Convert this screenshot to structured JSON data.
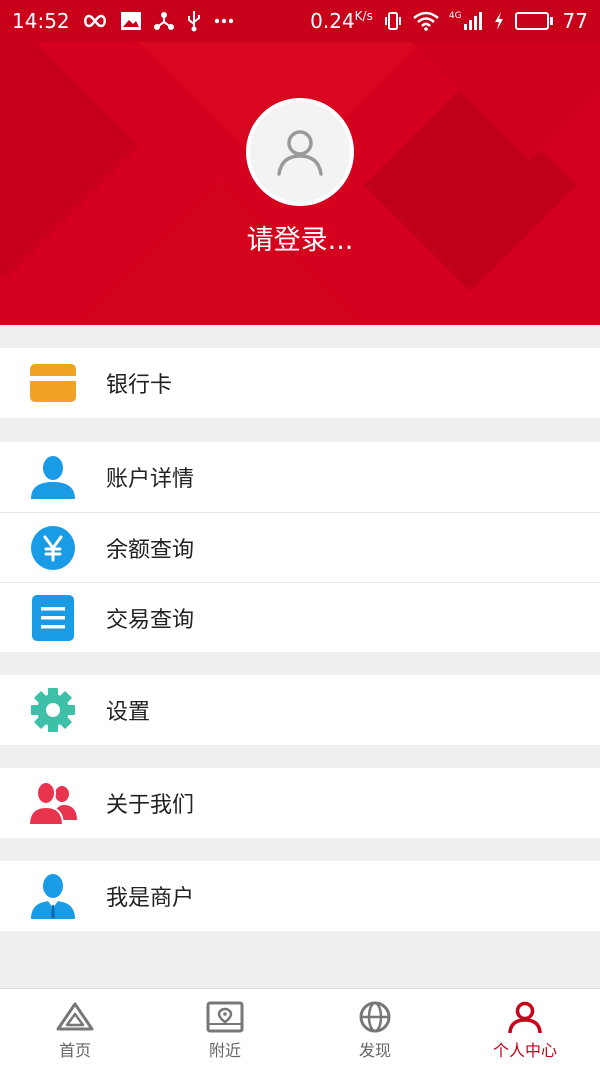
{
  "status_bar": {
    "time": "14:52",
    "net_speed": "0.24",
    "net_unit": "K/s",
    "network": "4G",
    "battery": "77",
    "battery_level": 0.77
  },
  "profile": {
    "login_prompt": "请登录..."
  },
  "menu": {
    "bank_card": "银行卡",
    "account_details": "账户详情",
    "balance_query": "余额查询",
    "transaction_query": "交易查询",
    "settings": "设置",
    "about_us": "关于我们",
    "merchant": "我是商户"
  },
  "colors": {
    "header_red": "#d5001d",
    "status_red": "#c8001a",
    "card_orange": "#f0a322",
    "icon_blue": "#1a9be6",
    "gear_teal": "#3dbfa8",
    "people_red": "#e8344e",
    "active_tab": "#c8001a"
  },
  "tabs": {
    "home": "首页",
    "nearby": "附近",
    "discover": "发现",
    "profile": "个人中心"
  }
}
